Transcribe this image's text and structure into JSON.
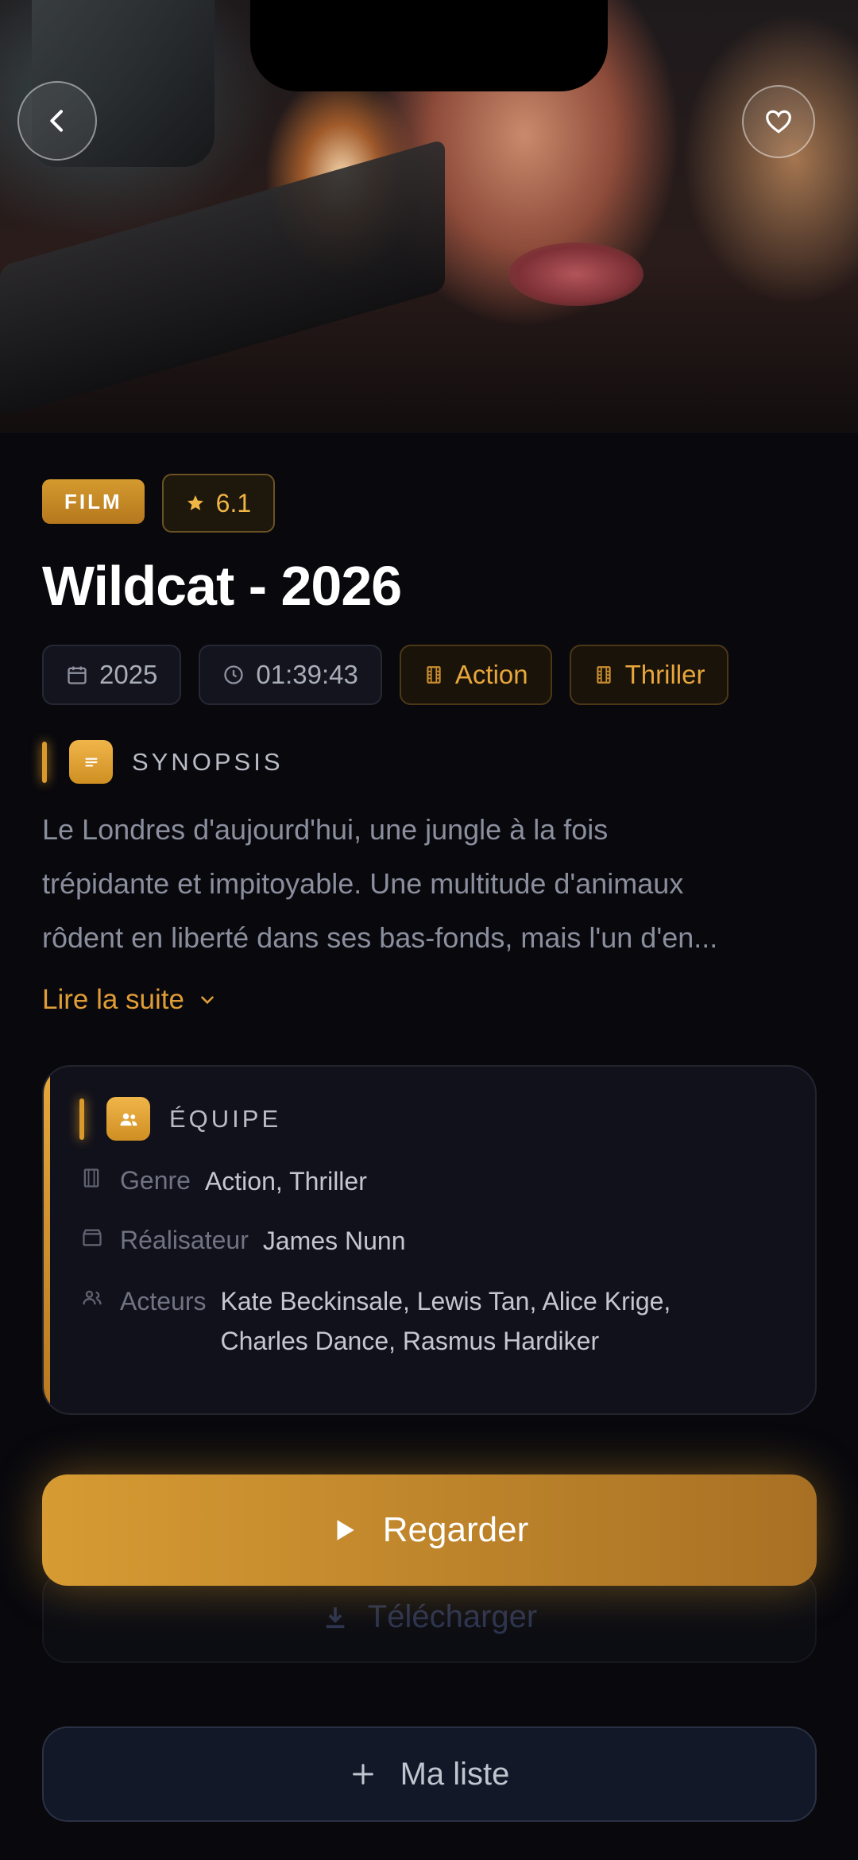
{
  "hero": {
    "image_alt": "Poster: woman aiming a rifle"
  },
  "header": {
    "back_icon": "chevron-left-icon",
    "favorite_icon": "heart-icon"
  },
  "badges": {
    "type": "FILM",
    "rating": "6.1"
  },
  "movie": {
    "title": "Wildcat - 2026"
  },
  "meta_chips": [
    {
      "icon": "calendar-icon",
      "label": "2025"
    },
    {
      "icon": "clock-icon",
      "label": "01:39:43"
    },
    {
      "icon": "film-icon",
      "label": "Action"
    },
    {
      "icon": "film-icon",
      "label": "Thriller"
    }
  ],
  "synopsis": {
    "heading": "SYNOPSIS",
    "lines": [
      "Le Londres d'aujourd'hui, une jungle à la fois",
      "trépidante et impitoyable. Une multitude d'animaux",
      "rôdent en liberté dans ses bas-fonds, mais l'un d'en..."
    ],
    "read_more": "Lire la suite"
  },
  "crew": {
    "heading": "ÉQUIPE",
    "genre_label": "Genre",
    "genre_value": "Action, Thriller",
    "director_label": "Réalisateur",
    "director_value": "James Nunn",
    "actors_label": "Acteurs",
    "actors_line1": "Kate Beckinsale, Lewis Tan, Alice Krige,",
    "actors_line2": "Charles Dance, Rasmus Hardiker"
  },
  "actions": {
    "watch": "Regarder",
    "download": "Télécharger",
    "my_list": "Ma liste"
  },
  "colors": {
    "accent": "#D99A2B",
    "background": "#08080D",
    "card": "#11111B"
  }
}
